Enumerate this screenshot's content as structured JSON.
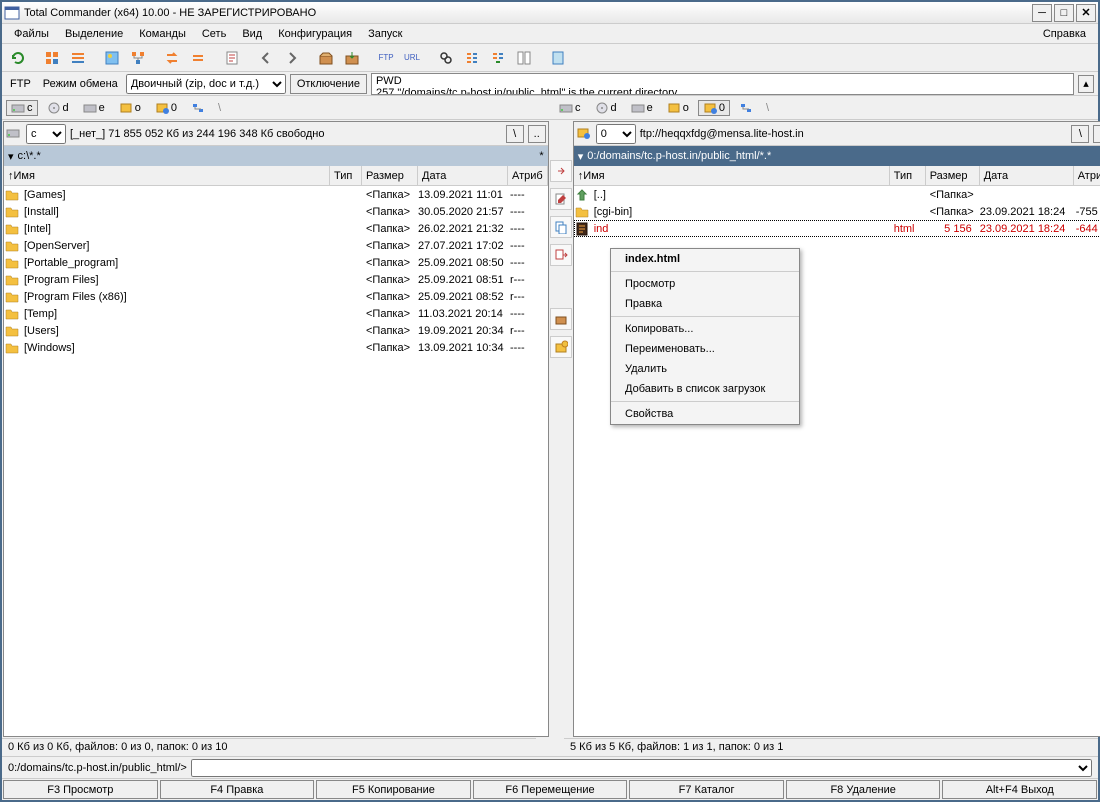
{
  "window": {
    "title": "Total Commander (x64) 10.00 - НЕ ЗАРЕГИСТРИРОВАНО"
  },
  "menu": {
    "items": [
      "Файлы",
      "Выделение",
      "Команды",
      "Сеть",
      "Вид",
      "Конфигурация",
      "Запуск"
    ],
    "help": "Справка"
  },
  "ftp": {
    "label": "FTP",
    "mode_label": "Режим обмена",
    "mode_value": "Двоичный (zip, doc и т.д.)",
    "disconnect": "Отключение",
    "status1": "PWD",
    "status2": "257 \"/domains/tc.p-host.in/public_html\" is the current directory"
  },
  "drives": [
    "c",
    "d",
    "e",
    "o",
    "0"
  ],
  "left": {
    "drive": "c",
    "info": "[_нет_]  71 855 052 Кб из 244 196 348 Кб свободно",
    "path": "c:\\*.*",
    "cols": {
      "name": "Имя",
      "type": "Тип",
      "size": "Размер",
      "date": "Дата",
      "attr": "Атриб"
    },
    "files": [
      {
        "n": "[Games]",
        "t": "",
        "s": "<Папка>",
        "d": "13.09.2021 11:01",
        "a": "----"
      },
      {
        "n": "[Install]",
        "t": "",
        "s": "<Папка>",
        "d": "30.05.2020 21:57",
        "a": "----"
      },
      {
        "n": "[Intel]",
        "t": "",
        "s": "<Папка>",
        "d": "26.02.2021 21:32",
        "a": "----"
      },
      {
        "n": "[OpenServer]",
        "t": "",
        "s": "<Папка>",
        "d": "27.07.2021 17:02",
        "a": "----"
      },
      {
        "n": "[Portable_program]",
        "t": "",
        "s": "<Папка>",
        "d": "25.09.2021 08:50",
        "a": "----"
      },
      {
        "n": "[Program Files]",
        "t": "",
        "s": "<Папка>",
        "d": "25.09.2021 08:51",
        "a": "r---"
      },
      {
        "n": "[Program Files (x86)]",
        "t": "",
        "s": "<Папка>",
        "d": "25.09.2021 08:52",
        "a": "r---"
      },
      {
        "n": "[Temp]",
        "t": "",
        "s": "<Папка>",
        "d": "11.03.2021 20:14",
        "a": "----"
      },
      {
        "n": "[Users]",
        "t": "",
        "s": "<Папка>",
        "d": "19.09.2021 20:34",
        "a": "r---"
      },
      {
        "n": "[Windows]",
        "t": "",
        "s": "<Папка>",
        "d": "13.09.2021 10:34",
        "a": "----"
      }
    ],
    "status": "0 Кб из 0 Кб, файлов: 0 из 0, папок: 0 из 10"
  },
  "right": {
    "drive": "0",
    "info": "ftp://heqqxfdg@mensa.lite-host.in",
    "path": "0:/domains/tc.p-host.in/public_html/*.*",
    "cols": {
      "name": "Имя",
      "type": "Тип",
      "size": "Размер",
      "date": "Дата",
      "attr": "Атриб"
    },
    "files": [
      {
        "n": "[..]",
        "t": "",
        "s": "<Папка>",
        "d": "",
        "a": "",
        "icon": "up"
      },
      {
        "n": "[cgi-bin]",
        "t": "",
        "s": "<Папка>",
        "d": "23.09.2021 18:24",
        "a": "-755"
      },
      {
        "n": "ind",
        "t": "html",
        "s": "5 156",
        "d": "23.09.2021 18:24",
        "a": "-644",
        "selected": true,
        "red": true
      }
    ],
    "status": "5 Кб из 5 Кб, файлов: 1 из 1, папок: 0 из 1"
  },
  "cmdline": {
    "prompt": "0:/domains/tc.p-host.in/public_html/>"
  },
  "fnkeys": [
    "F3 Просмотр",
    "F4 Правка",
    "F5 Копирование",
    "F6 Перемещение",
    "F7 Каталог",
    "F8 Удаление",
    "Alt+F4 Выход"
  ],
  "context": {
    "header": "index.html",
    "items": [
      "Просмотр",
      "Правка",
      "-",
      "Копировать...",
      "Переименовать...",
      "Удалить",
      "Добавить в список загрузок",
      "-",
      "Свойства"
    ]
  }
}
